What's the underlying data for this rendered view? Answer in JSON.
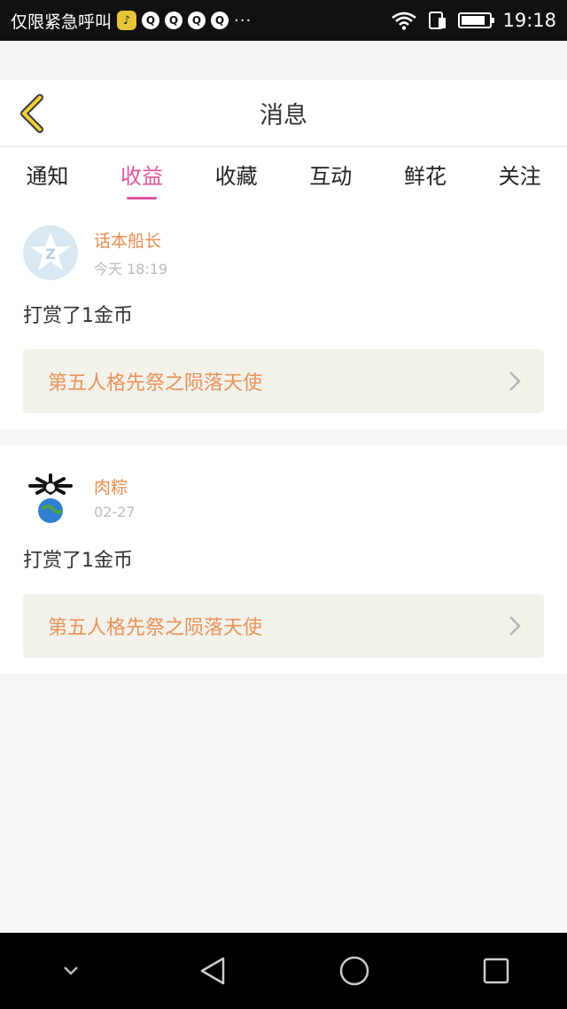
{
  "status_bar": {
    "carrier_text": "仅限紧急呼叫",
    "time": "19:18",
    "icons": [
      "music-icon",
      "qq-icon",
      "qq-icon",
      "qq-icon",
      "qq-icon",
      "more-dots-icon",
      "wifi-icon",
      "sim-icon",
      "battery-icon"
    ]
  },
  "header": {
    "title": "消息",
    "back_icon": "chevron-left-icon"
  },
  "tabs": [
    {
      "label": "通知",
      "active": false
    },
    {
      "label": "收益",
      "active": true
    },
    {
      "label": "收藏",
      "active": false
    },
    {
      "label": "互动",
      "active": false
    },
    {
      "label": "鲜花",
      "active": false
    },
    {
      "label": "关注",
      "active": false
    }
  ],
  "messages": [
    {
      "user": "话本船长",
      "time": "今天 18:19",
      "action": "打赏了1金币",
      "link_title": "第五人格先祭之陨落天使"
    },
    {
      "user": "肉粽",
      "time": "02-27",
      "action": "打赏了1金币",
      "link_title": "第五人格先祭之陨落天使"
    }
  ],
  "colors": {
    "accent": "#e0569b",
    "name": "#e88b4d",
    "link": "#e8935a",
    "link_bg": "#f2f1ea"
  }
}
